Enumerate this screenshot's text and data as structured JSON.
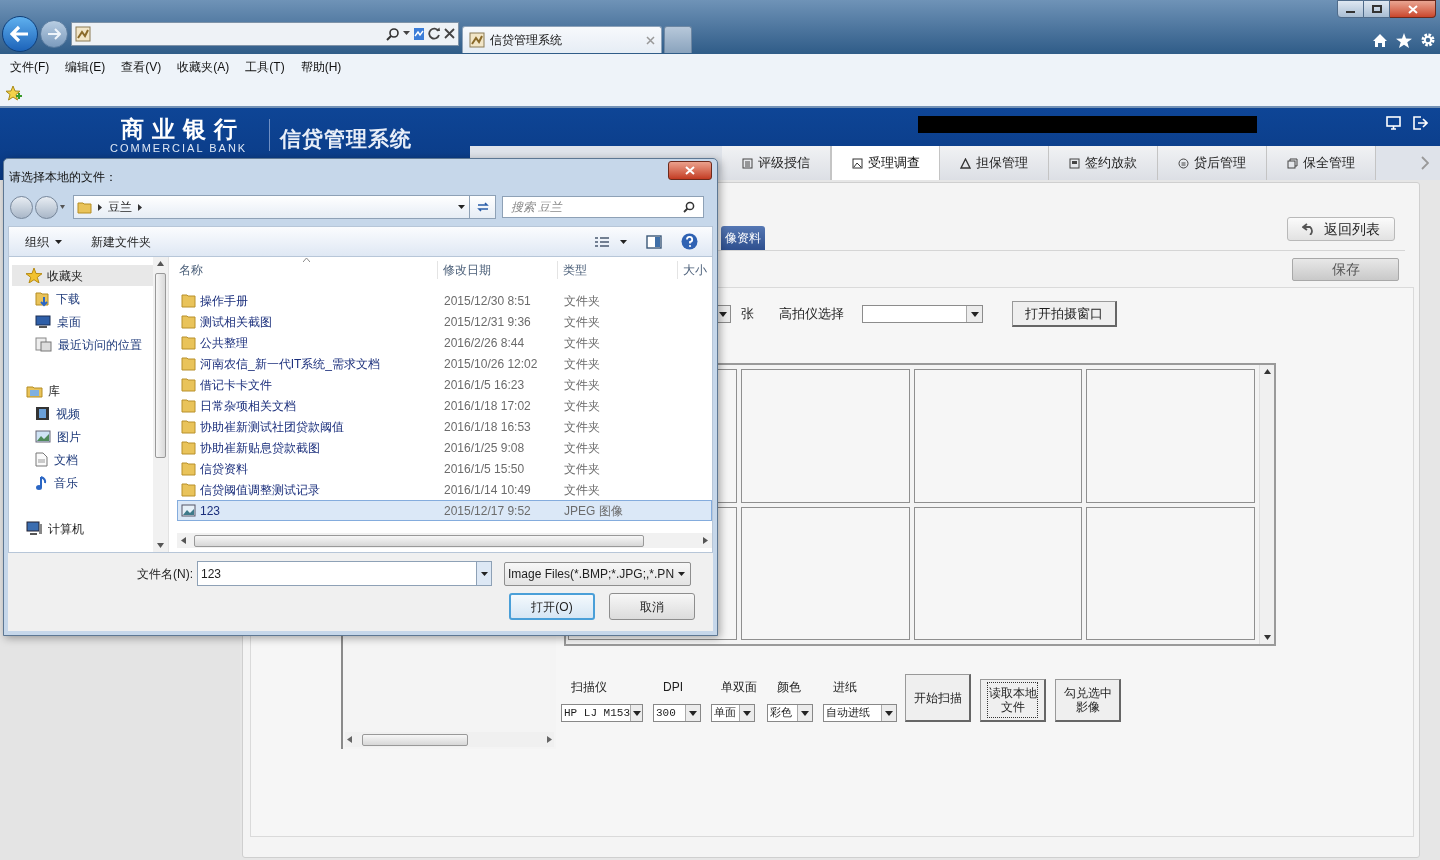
{
  "browser": {
    "tab_title": "信贷管理系统",
    "menu": [
      "文件(F)",
      "编辑(E)",
      "查看(V)",
      "收藏夹(A)",
      "工具(T)",
      "帮助(H)"
    ]
  },
  "app": {
    "bank_name": "商业银行",
    "bank_name_en": "COMMERCIAL BANK",
    "system_name": "信贷管理系统",
    "nav_tabs": [
      {
        "label": "评级授信",
        "selected": false
      },
      {
        "label": "受理调查",
        "selected": true
      },
      {
        "label": "担保管理",
        "selected": false
      },
      {
        "label": "签约放款",
        "selected": false
      },
      {
        "label": "贷后管理",
        "selected": false
      },
      {
        "label": "保全管理",
        "selected": false
      }
    ]
  },
  "page": {
    "section_tab": {
      "label": "像资料",
      "selected": true
    },
    "back_button": "返回列表",
    "save_button": "保存",
    "count_unit": "张",
    "camera_label": "高拍仪选择",
    "open_camera_button": "打开拍摄窗口",
    "scan_fields": [
      {
        "label": "扫描仪",
        "value": "HP LJ M153"
      },
      {
        "label": "DPI",
        "value": "300"
      },
      {
        "label": "单双面",
        "value": "单面"
      },
      {
        "label": "颜色",
        "value": "彩色"
      },
      {
        "label": "进纸",
        "value": "自动进纸"
      }
    ],
    "scan_buttons": [
      {
        "label": "开始扫描",
        "focused": false
      },
      {
        "label": "读取本地文件",
        "focused": true
      },
      {
        "label": "勾兑选中影像",
        "focused": false
      }
    ]
  },
  "dialog": {
    "title": "请选择本地的文件：",
    "breadcrumb": "豆兰",
    "search_placeholder": "搜索 豆兰",
    "organize": "组织",
    "new_folder": "新建文件夹",
    "nav": [
      {
        "label": "收藏夹",
        "selected": true,
        "children": [
          {
            "label": "下载",
            "selected": false
          },
          {
            "label": "桌面",
            "selected": false
          },
          {
            "label": "最近访问的位置",
            "selected": false
          }
        ]
      },
      {
        "label": "库",
        "selected": false,
        "children": [
          {
            "label": "视频",
            "selected": false
          },
          {
            "label": "图片",
            "selected": false
          },
          {
            "label": "文档",
            "selected": false
          },
          {
            "label": "音乐",
            "selected": false
          }
        ]
      },
      {
        "label": "计算机",
        "selected": false
      }
    ],
    "columns": [
      "名称",
      "修改日期",
      "类型",
      "大小"
    ],
    "files": [
      {
        "name": "操作手册",
        "date": "2015/12/30 8:51",
        "type": "文件夹",
        "kind": "folder",
        "selected": false
      },
      {
        "name": "测试相关截图",
        "date": "2015/12/31 9:36",
        "type": "文件夹",
        "kind": "folder",
        "selected": false
      },
      {
        "name": "公共整理",
        "date": "2016/2/26 8:44",
        "type": "文件夹",
        "kind": "folder",
        "selected": false
      },
      {
        "name": "河南农信_新一代IT系统_需求文档",
        "date": "2015/10/26 12:02",
        "type": "文件夹",
        "kind": "folder",
        "selected": false
      },
      {
        "name": "借记卡卡文件",
        "date": "2016/1/5 16:23",
        "type": "文件夹",
        "kind": "folder",
        "selected": false
      },
      {
        "name": "日常杂项相关文档",
        "date": "2016/1/18 17:02",
        "type": "文件夹",
        "kind": "folder",
        "selected": false
      },
      {
        "name": "协助崔新测试社团贷款阈值",
        "date": "2016/1/18 16:53",
        "type": "文件夹",
        "kind": "folder",
        "selected": false
      },
      {
        "name": "协助崔新贴息贷款截图",
        "date": "2016/1/25 9:08",
        "type": "文件夹",
        "kind": "folder",
        "selected": false
      },
      {
        "name": "信贷资料",
        "date": "2016/1/5 15:50",
        "type": "文件夹",
        "kind": "folder",
        "selected": false
      },
      {
        "name": "信贷阈值调整测试记录",
        "date": "2016/1/14 10:49",
        "type": "文件夹",
        "kind": "folder",
        "selected": false
      },
      {
        "name": "123",
        "date": "2015/12/17 9:52",
        "type": "JPEG 图像",
        "kind": "image",
        "selected": true
      }
    ],
    "filename_label": "文件名(N):",
    "filename": "123",
    "filter": "Image Files(*.BMP;*.JPG;,*.PN",
    "open_button": "打开(O)",
    "cancel_button": "取消"
  }
}
